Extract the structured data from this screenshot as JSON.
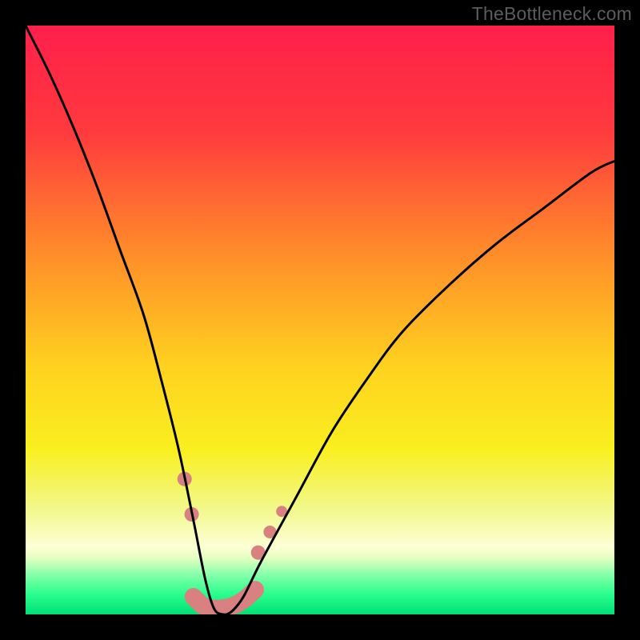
{
  "watermark": "TheBottleneck.com",
  "chart_data": {
    "type": "line",
    "title": "",
    "xlabel": "",
    "ylabel": "",
    "xlim": [
      0,
      100
    ],
    "ylim": [
      0,
      100
    ],
    "gradient_stops": [
      {
        "offset": 0.0,
        "color": "#ff1f4b"
      },
      {
        "offset": 0.18,
        "color": "#ff3a3e"
      },
      {
        "offset": 0.38,
        "color": "#ff8a2a"
      },
      {
        "offset": 0.58,
        "color": "#ffd21f"
      },
      {
        "offset": 0.72,
        "color": "#f9ef1f"
      },
      {
        "offset": 0.82,
        "color": "#f2f88a"
      },
      {
        "offset": 0.885,
        "color": "#fdffd6"
      },
      {
        "offset": 0.905,
        "color": "#e2ffc0"
      },
      {
        "offset": 0.93,
        "color": "#8dffad"
      },
      {
        "offset": 0.965,
        "color": "#2aff8d"
      },
      {
        "offset": 1.0,
        "color": "#00e076"
      }
    ],
    "series": [
      {
        "name": "bottleneck-curve",
        "x": [
          0,
          4,
          8,
          12,
          16,
          20,
          23,
          26,
          28.5,
          30.5,
          32,
          33.5,
          35,
          37,
          40,
          46,
          52,
          58,
          64,
          72,
          80,
          88,
          96,
          100
        ],
        "y": [
          100,
          92,
          83,
          73,
          62,
          51,
          40,
          28,
          16,
          6,
          1,
          0,
          0.5,
          3,
          9,
          20,
          31,
          40,
          48,
          56,
          63,
          69,
          75,
          77
        ]
      }
    ],
    "markers": [
      {
        "x": 27.0,
        "y": 23.0,
        "r": 9,
        "color": "#d98080"
      },
      {
        "x": 28.2,
        "y": 17.0,
        "r": 9,
        "color": "#d98080"
      },
      {
        "x": 39.5,
        "y": 10.5,
        "r": 9,
        "color": "#d98080"
      },
      {
        "x": 41.5,
        "y": 14.0,
        "r": 8,
        "color": "#d98080"
      },
      {
        "x": 43.5,
        "y": 17.5,
        "r": 7,
        "color": "#d98080"
      }
    ],
    "base_band": {
      "x": [
        28.5,
        30,
        31.5,
        33,
        34.5,
        36,
        37.5,
        39
      ],
      "y": [
        3.0,
        1.5,
        1.0,
        1.0,
        1.2,
        1.8,
        2.8,
        4.2
      ],
      "r": 11,
      "color": "#d98080"
    }
  }
}
